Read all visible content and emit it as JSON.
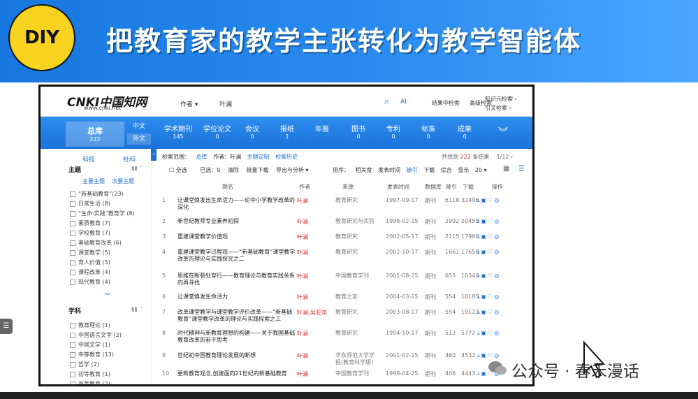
{
  "banner": {
    "badge": "DIY",
    "title": "把教育家的教学主张转化为教学智能体"
  },
  "cnki": {
    "logo": "CNKI中国知网",
    "logo_url": "www.cnki.net",
    "search_field": "作者 ▾",
    "search_value": "叶澜",
    "ai_label": "AI",
    "top_links": [
      "结果中检索",
      "高级检索",
      "知识元检索 ›",
      "引文检索 ›"
    ],
    "nav": {
      "zongku_label": "总库",
      "zongku_count": "222",
      "lang_cn": "中文",
      "lang_en": "外文",
      "items": [
        {
          "label": "学术期刊",
          "count": "145"
        },
        {
          "label": "学位论文",
          "count": "0"
        },
        {
          "label": "会议",
          "count": "0"
        },
        {
          "label": "报纸",
          "count": "1"
        },
        {
          "label": "年鉴",
          "count": ""
        },
        {
          "label": "图书",
          "count": "0"
        },
        {
          "label": "专利",
          "count": "0"
        },
        {
          "label": "标准",
          "count": "0"
        },
        {
          "label": "成果",
          "count": "0"
        }
      ]
    },
    "left": {
      "tabs": [
        "科技",
        "社科"
      ],
      "section1": "主题",
      "sub_links": [
        "主要主题",
        "次要主题"
      ],
      "topics": [
        "“新基础教育”(23)",
        "日常生活 (8)",
        "“生命·实践”教育学 (8)",
        "素质教育 (7)",
        "学校教育 (7)",
        "基础教育改革 (6)",
        "课堂教学 (5)",
        "育人价值 (5)",
        "课程改革 (4)",
        "现代教育 (4)"
      ],
      "section2": "学科",
      "subjects": [
        "教育理论 (1)",
        "中国语言文字 (2)",
        "中国文学 (1)",
        "中等教育 (13)",
        "哲学 (2)",
        "初等教育 (1)",
        "高等教育 (2)"
      ],
      "more": "︾"
    },
    "main": {
      "crumbs": [
        "检索范围：",
        "总库",
        "作者：叶澜",
        "主题定制",
        "检索历史"
      ],
      "total_prefix": "共找到",
      "total_count": "222",
      "total_suffix": "条结果",
      "page": "1/12",
      "toolbar": [
        "全选",
        "已选：0",
        "清除",
        "批量下载",
        "导出与分析 ▾"
      ],
      "sort": [
        "排序：",
        "相关度",
        "发表时间",
        "被引",
        "下载",
        "综合",
        "显示",
        "20 ▾"
      ],
      "headers": [
        "题名",
        "作者",
        "来源",
        "发表时间",
        "数据库",
        "被引",
        "下载",
        "操作"
      ],
      "rows": [
        {
          "idx": "1",
          "title": "让课堂焕发出生命活力——论中小学教学改革的深化",
          "author": "叶澜",
          "source": "教育研究",
          "date": "1997-09-17",
          "db": "期刊",
          "cite": "6118",
          "dl": "32496"
        },
        {
          "idx": "2",
          "title": "新世纪教师专业素养初探",
          "author": "叶澜",
          "source": "教育研究与实验",
          "date": "1998-02-15",
          "db": "期刊",
          "cite": "2992",
          "dl": "20458"
        },
        {
          "idx": "3",
          "title": "重建课堂教学价值观",
          "author": "叶澜",
          "source": "教育研究",
          "date": "2002-05-17",
          "db": "期刊",
          "cite": "2115",
          "dl": "17986"
        },
        {
          "idx": "4",
          "title": "重建课堂教学过程观——“新基础教育”课堂教学改革的理论与实践探究之二",
          "author": "叶澜",
          "source": "教育研究",
          "date": "2002-10-17",
          "db": "期刊",
          "cite": "1661",
          "dl": "17658"
        },
        {
          "idx": "5",
          "title": "思维在断裂处穿行——教育理论与教育实践关系的再寻找",
          "author": "叶澜",
          "source": "中国教育学刊",
          "date": "2001-08-25",
          "db": "期刊",
          "cite": "655",
          "dl": "10349"
        },
        {
          "idx": "6",
          "title": "让课堂焕发生命活力",
          "author": "叶澜",
          "source": "教育之友",
          "date": "2004-03-15",
          "db": "期刊",
          "cite": "554",
          "dl": "10185"
        },
        {
          "idx": "7",
          "title": "改革课堂教学与课堂教学评价改革——“新基础教育”课堂教学改革的理论与实践探索之三",
          "author": "叶澜;吴亚萍",
          "source": "教育研究",
          "date": "2003-08-17",
          "db": "期刊",
          "cite": "554",
          "dl": "19123"
        },
        {
          "idx": "8",
          "title": "时代精神与新教育理想的构建——关于我国基础教育改革的若干思考",
          "author": "叶澜",
          "source": "教育研究",
          "date": "1994-10-17",
          "db": "期刊",
          "cite": "512",
          "dl": "5772"
        },
        {
          "idx": "9",
          "title": "世纪初中国教育理论发展的断想",
          "author": "叶澜",
          "source": "华东师范大学学报(教育科学版)",
          "date": "2001-02-15",
          "db": "期刊",
          "cite": "460",
          "dl": "4532"
        },
        {
          "idx": "10",
          "title": "更新教育观念,创建面向21世纪的新基础教育",
          "author": "叶澜",
          "source": "中国教育学刊",
          "date": "1998-04-25",
          "db": "期刊",
          "cite": "406",
          "dl": "4443"
        }
      ]
    }
  },
  "watermark": "公众号 · 春禾漫话",
  "colors": {
    "banner": "#1e80e8",
    "badge": "#f7d21e",
    "cnki_blue": "#1a73d8",
    "author_red": "#e0302c"
  }
}
